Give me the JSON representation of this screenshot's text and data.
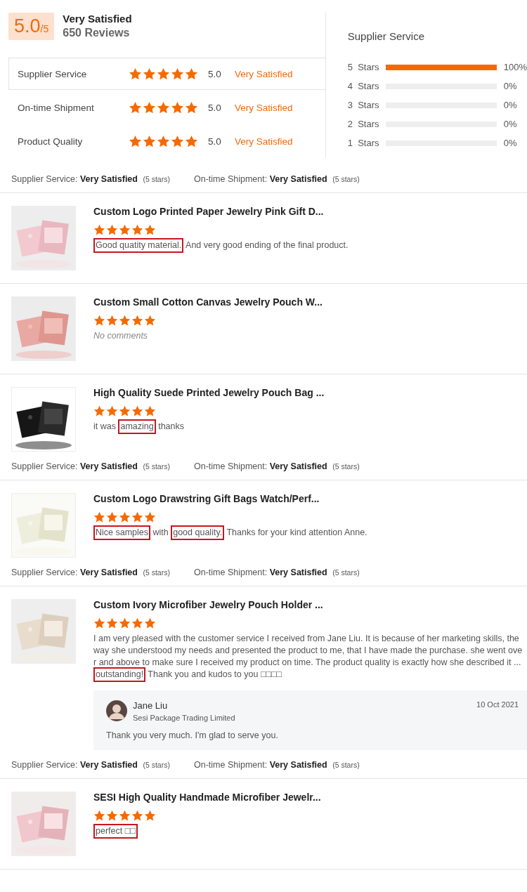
{
  "summary": {
    "score": "5.0",
    "out_of": "/5",
    "label": "Very Satisfied",
    "reviews": "650 Reviews"
  },
  "ratings": [
    {
      "label": "Supplier Service",
      "stars": 5,
      "score": "5.0",
      "verdict": "Very Satisfied",
      "selected": true
    },
    {
      "label": "On-time Shipment",
      "stars": 5,
      "score": "5.0",
      "verdict": "Very Satisfied",
      "selected": false
    },
    {
      "label": "Product Quality",
      "stars": 5,
      "score": "5.0",
      "verdict": "Very Satisfied",
      "selected": false
    }
  ],
  "breakdown": {
    "title": "Supplier Service",
    "rows": [
      {
        "label": "5  Stars",
        "level": 1,
        "percent": "100%"
      },
      {
        "label": "4  Stars",
        "level": 0,
        "percent": "0%"
      },
      {
        "label": "3  Stars",
        "level": 0,
        "percent": "0%"
      },
      {
        "label": "2  Stars",
        "level": 0,
        "percent": "0%"
      },
      {
        "label": "1  Stars",
        "level": 0,
        "percent": "0%"
      }
    ]
  },
  "feed": [
    {
      "kind": "ratings",
      "items": [
        {
          "label": "Supplier Service:",
          "value": "Very Satisfied",
          "note": "(5 stars)"
        },
        {
          "label": "On-time Shipment:",
          "value": "Very Satisfied",
          "note": "(5 stars)"
        }
      ]
    },
    {
      "kind": "review",
      "title": "Custom Logo Printed Paper Jewelry Pink Gift D...",
      "stars": 5,
      "empty": false,
      "comment": [
        {
          "text": "Good quatity material.",
          "highlighted": true
        },
        {
          "text": " And very good ending of the final product.",
          "highlighted": false
        }
      ]
    },
    {
      "kind": "review",
      "title": "Custom Small Cotton Canvas Jewelry Pouch W...",
      "stars": 5,
      "empty": true,
      "comment": [
        {
          "text": "No comments",
          "highlighted": false
        }
      ]
    },
    {
      "kind": "review",
      "title": "High Quality Suede Printed Jewelry Pouch Bag ...",
      "stars": 5,
      "empty": false,
      "comment": [
        {
          "text": "it was ",
          "highlighted": false
        },
        {
          "text": "amazing",
          "highlighted": true
        },
        {
          "text": " thanks",
          "highlighted": false
        }
      ]
    },
    {
      "kind": "ratings",
      "items": [
        {
          "label": "Supplier Service:",
          "value": "Very Satisfied",
          "note": "(5 stars)"
        },
        {
          "label": "On-time Shipment:",
          "value": "Very Satisfied",
          "note": "(5 stars)"
        }
      ]
    },
    {
      "kind": "review",
      "title": "Custom Logo Drawstring Gift Bags Watch/Perf...",
      "stars": 5,
      "empty": false,
      "comment": [
        {
          "text": "Nice samples",
          "highlighted": true
        },
        {
          "text": " with ",
          "highlighted": false
        },
        {
          "text": "good quality.",
          "highlighted": true
        },
        {
          "text": " Thanks for your kind attention Anne.",
          "highlighted": false
        }
      ]
    },
    {
      "kind": "ratings",
      "items": [
        {
          "label": "Supplier Service:",
          "value": "Very Satisfied",
          "note": "(5 stars)"
        },
        {
          "label": "On-time Shipment:",
          "value": "Very Satisfied",
          "note": "(5 stars)"
        }
      ]
    },
    {
      "kind": "review",
      "title": "Custom Ivory Microfiber Jewelry Pouch Holder ...",
      "stars": 5,
      "empty": false,
      "comment": [
        {
          "text": "I am very pleased with the customer service I received from Jane Liu. It is because of her marketing skills, the way she understood my needs and presented the product to me, that I have made the purchase. she went over and above to make sure I received my product on time. The product quality is exactly how she described it ... ",
          "highlighted": false
        },
        {
          "text": "outstanding!",
          "highlighted": true
        },
        {
          "text": " Thank you and kudos to you □□□□",
          "highlighted": false
        }
      ],
      "reply": {
        "name": "Jane Liu",
        "company": "Sesi Package Trading Limited",
        "date": "10 Oct 2021",
        "text": "Thank you very much. I'm glad to serve you."
      }
    },
    {
      "kind": "ratings",
      "items": [
        {
          "label": "Supplier Service:",
          "value": "Very Satisfied",
          "note": "(5 stars)"
        },
        {
          "label": "On-time Shipment:",
          "value": "Very Satisfied",
          "note": "(5 stars)"
        }
      ]
    },
    {
      "kind": "review",
      "title": "SESI High Quality Handmade Microfiber Jewelr...",
      "stars": 5,
      "empty": false,
      "comment": [
        {
          "text": "perfect □□",
          "highlighted": true
        }
      ]
    }
  ]
}
